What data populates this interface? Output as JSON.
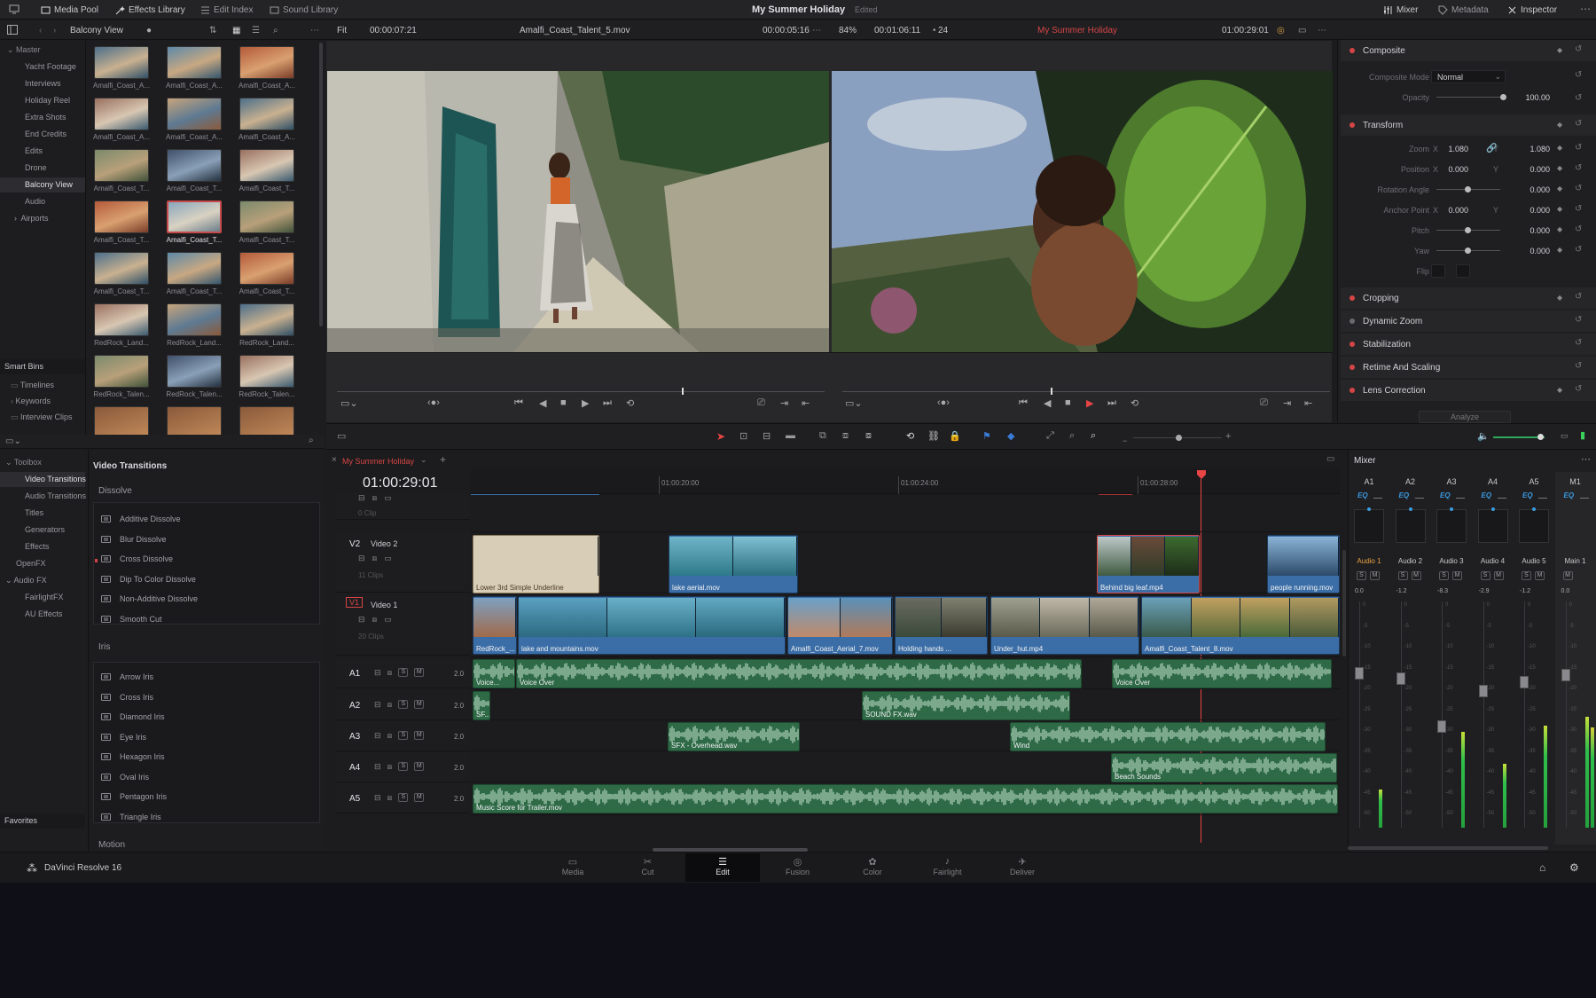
{
  "topbar": {
    "media_pool": "Media Pool",
    "effects_library": "Effects Library",
    "edit_index": "Edit Index",
    "sound_library": "Sound Library",
    "project_title": "My Summer Holiday",
    "project_status": "Edited",
    "mixer": "Mixer",
    "metadata": "Metadata",
    "inspector": "Inspector"
  },
  "viewer_bar": {
    "bin_name": "Balcony View",
    "fit": "Fit",
    "source_timecode": "00:00:07:21",
    "source_clip": "Amalfi_Coast_Talent_5.mov",
    "source_duration": "00:00:05:16",
    "zoom": "84%",
    "record_duration": "00:01:06:11",
    "fps": "24",
    "timeline_name": "My Summer Holiday",
    "record_timecode": "01:00:29:01"
  },
  "bins": {
    "items": [
      "Master",
      "Yacht Footage",
      "Interviews",
      "Holiday Reel",
      "Extra Shots",
      "End Credits",
      "Edits",
      "Drone",
      "Balcony View",
      "Audio",
      "Airports"
    ],
    "smart_bins": "Smart Bins",
    "smart_items": [
      "Timelines",
      "Keywords",
      "Interview Clips"
    ]
  },
  "clips": [
    "Amalfi_Coast_A...",
    "Amalfi_Coast_A...",
    "Amalfi_Coast_A...",
    "Amalfi_Coast_A...",
    "Amalfi_Coast_A...",
    "Amalfi_Coast_A...",
    "Amalfi_Coast_T...",
    "Amalfi_Coast_T...",
    "Amalfi_Coast_T...",
    "Amalfi_Coast_T...",
    "Amalfi_Coast_T...",
    "Amalfi_Coast_T...",
    "Amalfi_Coast_T...",
    "Amalfi_Coast_T...",
    "Amalfi_Coast_T...",
    "RedRock_Land...",
    "RedRock_Land...",
    "RedRock_Land...",
    "RedRock_Talen...",
    "RedRock_Talen...",
    "RedRock_Talen..."
  ],
  "effects": {
    "toolbox": "Toolbox",
    "video_transitions": "Video Transitions",
    "audio_transitions": "Audio Transitions",
    "titles": "Titles",
    "generators": "Generators",
    "effects": "Effects",
    "openfx": "OpenFX",
    "audio_fx": "Audio FX",
    "fairlightfx": "FairlightFX",
    "au_effects": "AU Effects",
    "favorites": "Favorites",
    "panel_title": "Video Transitions",
    "dissolve_header": "Dissolve",
    "dissolve": [
      "Additive Dissolve",
      "Blur Dissolve",
      "Cross Dissolve",
      "Dip To Color Dissolve",
      "Non-Additive Dissolve",
      "Smooth Cut"
    ],
    "iris_header": "Iris",
    "iris": [
      "Arrow Iris",
      "Cross Iris",
      "Diamond Iris",
      "Eye Iris",
      "Hexagon Iris",
      "Oval Iris",
      "Pentagon Iris",
      "Triangle Iris"
    ],
    "motion_header": "Motion"
  },
  "inspector": {
    "composite": "Composite",
    "composite_mode_label": "Composite Mode",
    "composite_mode": "Normal",
    "opacity_label": "Opacity",
    "opacity": "100.00",
    "transform": "Transform",
    "zoom_label": "Zoom",
    "zoom_x": "1.080",
    "zoom_y": "1.080",
    "position_label": "Position",
    "position_x": "0.000",
    "position_y": "0.000",
    "rotation_label": "Rotation Angle",
    "rotation": "0.000",
    "anchor_label": "Anchor Point",
    "anchor_x": "0.000",
    "anchor_y": "0.000",
    "pitch_label": "Pitch",
    "pitch": "0.000",
    "yaw_label": "Yaw",
    "yaw": "0.000",
    "flip_label": "Flip",
    "x": "X",
    "y": "Y",
    "cropping": "Cropping",
    "dynamic_zoom": "Dynamic Zoom",
    "stabilization": "Stabilization",
    "retime": "Retime And Scaling",
    "lens": "Lens Correction",
    "analyze": "Analyze"
  },
  "timeline": {
    "tab": "My Summer Holiday",
    "timecode": "01:00:29:01",
    "ruler": [
      "01:00:20:00",
      "01:00:24:00",
      "01:00:28:00"
    ],
    "v2": {
      "id": "V2",
      "name": "Video 2",
      "count": "11 Clips"
    },
    "v1": {
      "id": "V1",
      "name": "Video 1",
      "count": "20 Clips"
    },
    "top_count": "0 Clip",
    "audio_tracks": [
      {
        "id": "A1",
        "level": "2.0"
      },
      {
        "id": "A2",
        "level": "2.0"
      },
      {
        "id": "A3",
        "level": "2.0"
      },
      {
        "id": "A4",
        "level": "2.0"
      },
      {
        "id": "A5",
        "level": "2.0"
      }
    ],
    "v2_clips": [
      "Lower 3rd Simple Underline",
      "lake aerial.mov",
      "Behind big leaf.mp4",
      "people running.mov"
    ],
    "v1_clips": [
      "RedRock_...",
      "lake and mountains.mov",
      "Amalfi_Coast_Aerial_7.mov",
      "Holding hands ...",
      "Under_hut.mp4",
      "Amalfi_Coast_Talent_8.mov"
    ],
    "a_clips": [
      "Voice...",
      "Voice Over",
      "Voice Over",
      "SF...",
      "SOUND FX.wav",
      "SFX - Overhead.wav",
      "Wind",
      "Beach Sounds",
      "Music Score for Trailer.mov"
    ],
    "s": "S",
    "m": "M"
  },
  "mixer": {
    "title": "Mixer",
    "channels": [
      {
        "id": "A1",
        "name": "Audio 1",
        "gain": "0.0",
        "meter": 0.18
      },
      {
        "id": "A2",
        "name": "Audio 2",
        "gain": "-1.2",
        "meter": 0.0
      },
      {
        "id": "A3",
        "name": "Audio 3",
        "gain": "-8.3",
        "meter": 0.45
      },
      {
        "id": "A4",
        "name": "Audio 4",
        "gain": "-2.9",
        "meter": 0.3
      },
      {
        "id": "A5",
        "name": "Audio 5",
        "gain": "-1.2",
        "meter": 0.48
      },
      {
        "id": "M1",
        "name": "Main 1",
        "gain": "0.0",
        "meter": 0.52
      }
    ],
    "eq": "EQ",
    "scale": [
      "0",
      "-5",
      "-10",
      "-15",
      "-20",
      "-25",
      "-30",
      "-35",
      "-40",
      "-45",
      "-50"
    ]
  },
  "pages": [
    "Media",
    "Cut",
    "Edit",
    "Fusion",
    "Color",
    "Fairlight",
    "Deliver"
  ],
  "app_name": "DaVinci Resolve 16",
  "colors": {
    "accent_red": "#d64545",
    "video_clip": "#3b6ea7",
    "audio_clip": "#2f6a47",
    "selected_clip": "#c74a4a"
  }
}
